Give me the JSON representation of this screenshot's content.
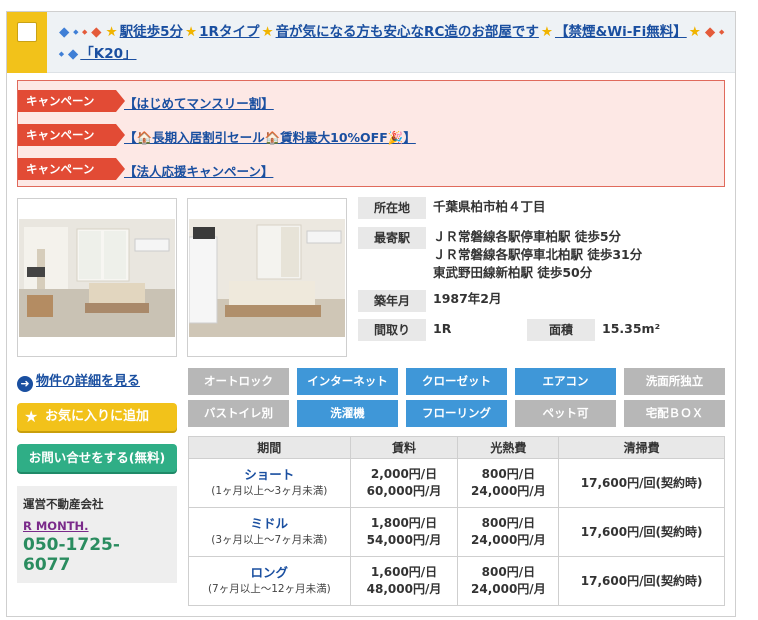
{
  "header": {
    "title_segments": [
      {
        "type": "icon",
        "name": "blue-diamond-icon",
        "glyph": "◆",
        "color": "blue"
      },
      {
        "type": "icon",
        "name": "small-blue-diamond-icon",
        "glyph": "⬩",
        "color": "blue"
      },
      {
        "type": "icon",
        "name": "small-red-diamond-icon",
        "glyph": "⬩",
        "color": "red"
      },
      {
        "type": "icon",
        "name": "red-diamond-icon",
        "glyph": "◆",
        "color": "red"
      },
      {
        "type": "icon",
        "name": "star-icon",
        "glyph": "★",
        "color": "star"
      },
      {
        "type": "text",
        "text": "駅徒歩5分"
      },
      {
        "type": "icon",
        "name": "star-icon",
        "glyph": "★",
        "color": "star"
      },
      {
        "type": "text",
        "text": "1Rタイプ"
      },
      {
        "type": "icon",
        "name": "star-icon",
        "glyph": "★",
        "color": "star"
      },
      {
        "type": "text",
        "text": "音が気になる方も安心なRC造のお部屋です"
      },
      {
        "type": "icon",
        "name": "star-icon",
        "glyph": "★",
        "color": "star"
      },
      {
        "type": "text",
        "text": "【禁煙&Wi-Fi無料】"
      },
      {
        "type": "icon",
        "name": "star-icon",
        "glyph": "★",
        "color": "star"
      },
      {
        "type": "icon",
        "name": "red-diamond-icon",
        "glyph": "◆",
        "color": "red"
      },
      {
        "type": "icon",
        "name": "small-red-diamond-icon",
        "glyph": "⬩",
        "color": "red"
      },
      {
        "type": "icon",
        "name": "small-blue-diamond-icon",
        "glyph": "⬩",
        "color": "blue"
      },
      {
        "type": "icon",
        "name": "blue-diamond-icon",
        "glyph": "◆",
        "color": "blue"
      },
      {
        "type": "text",
        "text": "「K20」"
      }
    ]
  },
  "campaigns": [
    {
      "tag": "キャンペーン",
      "text": "【はじめてマンスリー割】"
    },
    {
      "tag": "キャンペーン",
      "text": "【🏠長期入居割引セール🏠賃料最大10%OFF🎉】"
    },
    {
      "tag": "キャンペーン",
      "text": "【法人応援キャンペーン】"
    }
  ],
  "info": {
    "location_label": "所在地",
    "location_value": "千葉県柏市柏４丁目",
    "station_label": "最寄駅",
    "station_lines": [
      "ＪＲ常磐線各駅停車柏駅 徒歩5分",
      "ＪＲ常磐線各駅停車北柏駅 徒歩31分",
      "東武野田線新柏駅 徒歩50分"
    ],
    "built_label": "築年月",
    "built_value": "1987年2月",
    "layout_label": "間取り",
    "layout_value": "1R",
    "area_label": "面積",
    "area_value": "15.35m²"
  },
  "actions": {
    "detail_link": "物件の詳細を見る",
    "favorite": "お気に入りに追加",
    "contact": "お問い合せをする(無料)"
  },
  "agency": {
    "label": "運営不動産会社",
    "name": "R MONTH.",
    "tel_line1": "050-1725-",
    "tel_line2": "6077"
  },
  "features": [
    {
      "label": "オートロック",
      "on": false
    },
    {
      "label": "インターネット",
      "on": true
    },
    {
      "label": "クローゼット",
      "on": true
    },
    {
      "label": "エアコン",
      "on": true
    },
    {
      "label": "洗面所独立",
      "on": false
    },
    {
      "label": "バストイレ別",
      "on": false
    },
    {
      "label": "洗濯機",
      "on": true
    },
    {
      "label": "フローリング",
      "on": true
    },
    {
      "label": "ペット可",
      "on": false
    },
    {
      "label": "宅配ＢＯＸ",
      "on": false
    }
  ],
  "price_table": {
    "headers": [
      "期間",
      "賃料",
      "光熱費",
      "清掃費"
    ],
    "rows": [
      {
        "plan": "ショート",
        "period": "(1ヶ月以上～3ヶ月未満)",
        "rent_day": "2,000円/日",
        "rent_month": "60,000円/月",
        "util_day": "800円/日",
        "util_month": "24,000円/月",
        "cleaning": "17,600円/回(契約時)"
      },
      {
        "plan": "ミドル",
        "period": "(3ヶ月以上～7ヶ月未満)",
        "rent_day": "1,800円/日",
        "rent_month": "54,000円/月",
        "util_day": "800円/日",
        "util_month": "24,000円/月",
        "cleaning": "17,600円/回(契約時)"
      },
      {
        "plan": "ロング",
        "period": "(7ヶ月以上～12ヶ月未満)",
        "rent_day": "1,600円/日",
        "rent_month": "48,000円/月",
        "util_day": "800円/日",
        "util_month": "24,000円/月",
        "cleaning": "17,600円/回(契約時)"
      }
    ]
  },
  "colors": {
    "accent_yellow": "#f2c21a",
    "campaign_red": "#e24b35",
    "link_blue": "#1a4fa0",
    "feature_on": "#3f97d8",
    "feature_off": "#b7b7b7",
    "contact_green": "#2fae86"
  }
}
